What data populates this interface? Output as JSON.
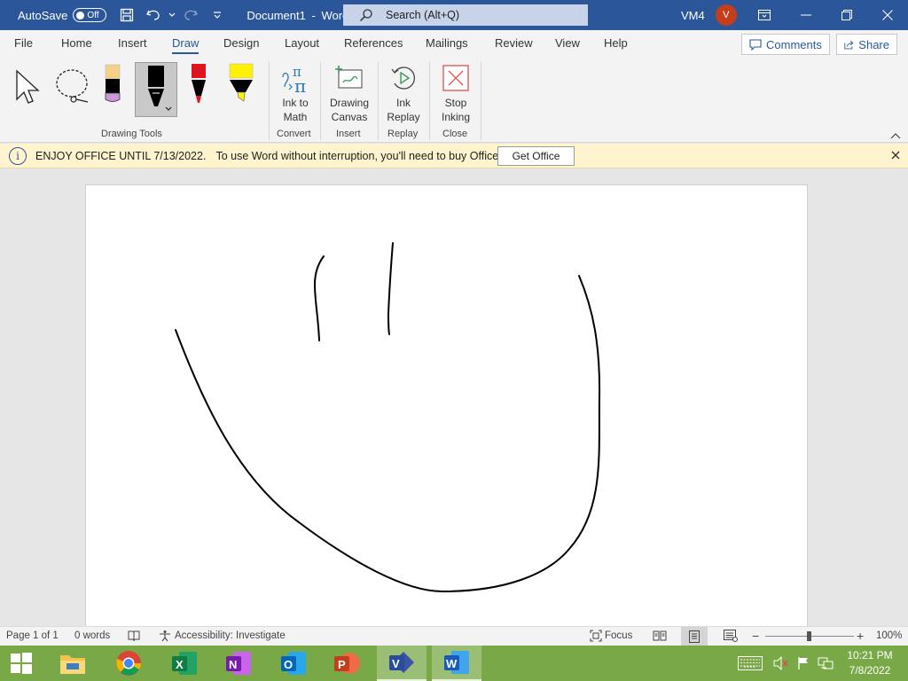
{
  "titlebar": {
    "autosave_label": "AutoSave",
    "autosave_state": "Off",
    "document_title": "Document1",
    "title_separator": "-",
    "app_name": "Word",
    "search_placeholder": "Search (Alt+Q)",
    "user_initials": "VM4",
    "avatar_letter": "V"
  },
  "menu": {
    "tabs": [
      "File",
      "Home",
      "Insert",
      "Draw",
      "Design",
      "Layout",
      "References",
      "Mailings",
      "Review",
      "View",
      "Help"
    ],
    "active_tab": "Draw",
    "comments_label": "Comments",
    "share_label": "Share"
  },
  "ribbon": {
    "groups": {
      "drawing_tools": "Drawing Tools",
      "convert": "Convert",
      "insert": "Insert",
      "replay": "Replay",
      "close": "Close"
    },
    "buttons": {
      "ink_to_math": [
        "Ink to",
        "Math"
      ],
      "drawing_canvas": [
        "Drawing",
        "Canvas"
      ],
      "ink_replay": [
        "Ink",
        "Replay"
      ],
      "stop_inking": [
        "Stop",
        "Inking"
      ]
    },
    "pen_colors": {
      "pencil_tip": "#c898d8",
      "black_pen": "#000000",
      "red_pen": "#e0141e",
      "highlighter": "#fff200"
    }
  },
  "infobar": {
    "headline": "ENJOY OFFICE UNTIL 7/13/2022.",
    "message": "To use Word without interruption, you'll need to buy Office.",
    "button_label": "Get Office"
  },
  "statusbar": {
    "page": "Page 1 of 1",
    "words": "0 words",
    "accessibility": "Accessibility: Investigate",
    "focus": "Focus",
    "zoom": "100%"
  },
  "taskbar": {
    "time": "10:21 PM",
    "date": "7/8/2022"
  },
  "colors": {
    "titlebar": "#2b579a",
    "taskbar": "#79a846",
    "infobar": "#fff4ce"
  }
}
